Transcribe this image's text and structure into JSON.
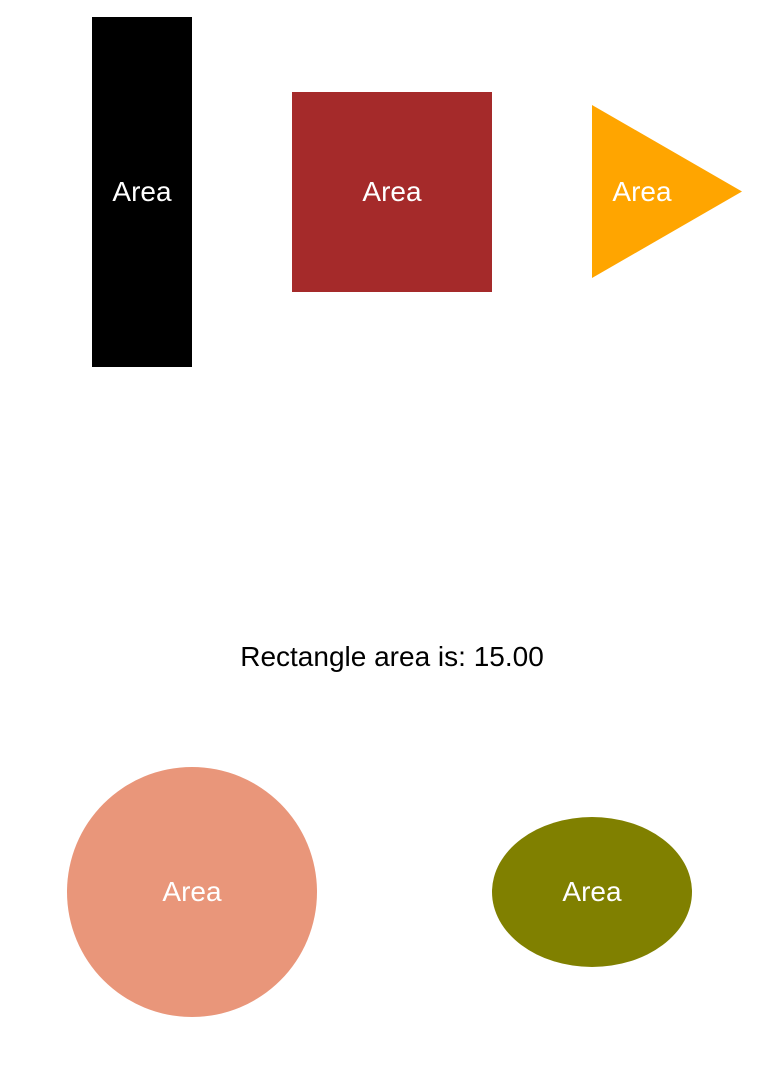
{
  "shapes": {
    "rectangle": {
      "label": "Area",
      "color": "#000000"
    },
    "square": {
      "label": "Area",
      "color": "#a52a2a"
    },
    "triangle": {
      "label": "Area",
      "color": "#ffa500"
    },
    "circle": {
      "label": "Area",
      "color": "#e9967a"
    },
    "ellipse": {
      "label": "Area",
      "color": "#808000"
    }
  },
  "result": {
    "text": "Rectangle area is: 15.00"
  }
}
